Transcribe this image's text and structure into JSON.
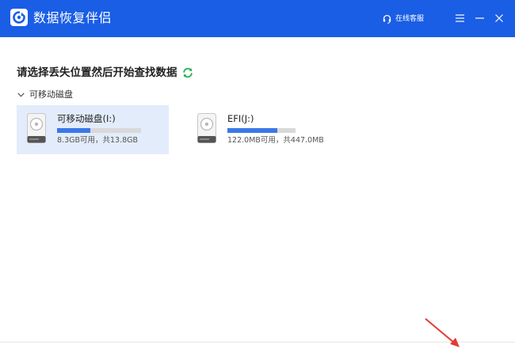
{
  "window": {
    "title": "数据恢复伴侣",
    "service_label": "在线客服",
    "accent_color": "#1a5ee6"
  },
  "main": {
    "prompt": "请选择丢失位置然后开始查找数据",
    "section_label": "可移动磁盘",
    "drives": [
      {
        "name": "可移动磁盘(I:)",
        "size": "8.3GB可用，共13.8GB",
        "used_fraction": 0.4,
        "selected": true
      },
      {
        "name": "EFI(J:)",
        "size": "122.0MB可用，共447.0MB",
        "used_fraction": 0.73,
        "selected": false
      }
    ]
  },
  "icons": [
    "app-logo-icon",
    "headset-icon",
    "menu-icon",
    "minimize-icon",
    "close-icon",
    "refresh-icon",
    "chevron-down-icon",
    "disk-drive-icon",
    "annotation-arrow-icon"
  ],
  "colors": {
    "accent": "#1a5ee6",
    "progress": "#3b78e7",
    "selected_bg": "#e3ecfb",
    "refresh": "#22b14c",
    "annotation": "#e53935"
  }
}
